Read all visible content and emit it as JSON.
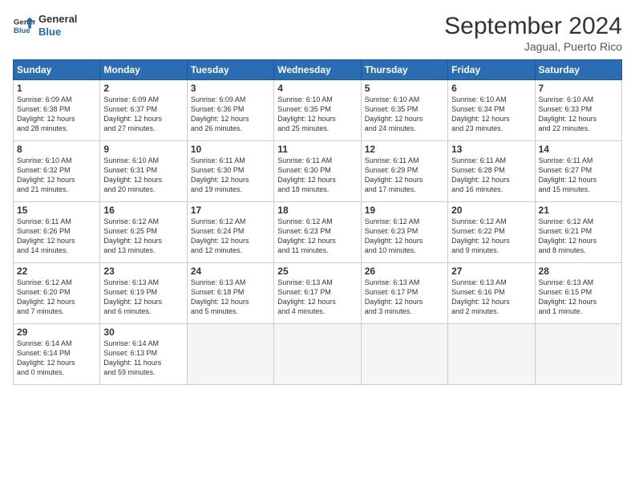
{
  "logo": {
    "line1": "General",
    "line2": "Blue"
  },
  "title": "September 2024",
  "subtitle": "Jagual, Puerto Rico",
  "days_of_week": [
    "Sunday",
    "Monday",
    "Tuesday",
    "Wednesday",
    "Thursday",
    "Friday",
    "Saturday"
  ],
  "weeks": [
    [
      {
        "num": "1",
        "sunrise": "6:09 AM",
        "sunset": "6:38 PM",
        "daylight": "12 hours and 28 minutes."
      },
      {
        "num": "2",
        "sunrise": "6:09 AM",
        "sunset": "6:37 PM",
        "daylight": "12 hours and 27 minutes."
      },
      {
        "num": "3",
        "sunrise": "6:09 AM",
        "sunset": "6:36 PM",
        "daylight": "12 hours and 26 minutes."
      },
      {
        "num": "4",
        "sunrise": "6:10 AM",
        "sunset": "6:35 PM",
        "daylight": "12 hours and 25 minutes."
      },
      {
        "num": "5",
        "sunrise": "6:10 AM",
        "sunset": "6:35 PM",
        "daylight": "12 hours and 24 minutes."
      },
      {
        "num": "6",
        "sunrise": "6:10 AM",
        "sunset": "6:34 PM",
        "daylight": "12 hours and 23 minutes."
      },
      {
        "num": "7",
        "sunrise": "6:10 AM",
        "sunset": "6:33 PM",
        "daylight": "12 hours and 22 minutes."
      }
    ],
    [
      {
        "num": "8",
        "sunrise": "6:10 AM",
        "sunset": "6:32 PM",
        "daylight": "12 hours and 21 minutes."
      },
      {
        "num": "9",
        "sunrise": "6:10 AM",
        "sunset": "6:31 PM",
        "daylight": "12 hours and 20 minutes."
      },
      {
        "num": "10",
        "sunrise": "6:11 AM",
        "sunset": "6:30 PM",
        "daylight": "12 hours and 19 minutes."
      },
      {
        "num": "11",
        "sunrise": "6:11 AM",
        "sunset": "6:30 PM",
        "daylight": "12 hours and 18 minutes."
      },
      {
        "num": "12",
        "sunrise": "6:11 AM",
        "sunset": "6:29 PM",
        "daylight": "12 hours and 17 minutes."
      },
      {
        "num": "13",
        "sunrise": "6:11 AM",
        "sunset": "6:28 PM",
        "daylight": "12 hours and 16 minutes."
      },
      {
        "num": "14",
        "sunrise": "6:11 AM",
        "sunset": "6:27 PM",
        "daylight": "12 hours and 15 minutes."
      }
    ],
    [
      {
        "num": "15",
        "sunrise": "6:11 AM",
        "sunset": "6:26 PM",
        "daylight": "12 hours and 14 minutes."
      },
      {
        "num": "16",
        "sunrise": "6:12 AM",
        "sunset": "6:25 PM",
        "daylight": "12 hours and 13 minutes."
      },
      {
        "num": "17",
        "sunrise": "6:12 AM",
        "sunset": "6:24 PM",
        "daylight": "12 hours and 12 minutes."
      },
      {
        "num": "18",
        "sunrise": "6:12 AM",
        "sunset": "6:23 PM",
        "daylight": "12 hours and 11 minutes."
      },
      {
        "num": "19",
        "sunrise": "6:12 AM",
        "sunset": "6:23 PM",
        "daylight": "12 hours and 10 minutes."
      },
      {
        "num": "20",
        "sunrise": "6:12 AM",
        "sunset": "6:22 PM",
        "daylight": "12 hours and 9 minutes."
      },
      {
        "num": "21",
        "sunrise": "6:12 AM",
        "sunset": "6:21 PM",
        "daylight": "12 hours and 8 minutes."
      }
    ],
    [
      {
        "num": "22",
        "sunrise": "6:12 AM",
        "sunset": "6:20 PM",
        "daylight": "12 hours and 7 minutes."
      },
      {
        "num": "23",
        "sunrise": "6:13 AM",
        "sunset": "6:19 PM",
        "daylight": "12 hours and 6 minutes."
      },
      {
        "num": "24",
        "sunrise": "6:13 AM",
        "sunset": "6:18 PM",
        "daylight": "12 hours and 5 minutes."
      },
      {
        "num": "25",
        "sunrise": "6:13 AM",
        "sunset": "6:17 PM",
        "daylight": "12 hours and 4 minutes."
      },
      {
        "num": "26",
        "sunrise": "6:13 AM",
        "sunset": "6:17 PM",
        "daylight": "12 hours and 3 minutes."
      },
      {
        "num": "27",
        "sunrise": "6:13 AM",
        "sunset": "6:16 PM",
        "daylight": "12 hours and 2 minutes."
      },
      {
        "num": "28",
        "sunrise": "6:13 AM",
        "sunset": "6:15 PM",
        "daylight": "12 hours and 1 minute."
      }
    ],
    [
      {
        "num": "29",
        "sunrise": "6:14 AM",
        "sunset": "6:14 PM",
        "daylight": "12 hours and 0 minutes."
      },
      {
        "num": "30",
        "sunrise": "6:14 AM",
        "sunset": "6:13 PM",
        "daylight": "11 hours and 59 minutes."
      },
      null,
      null,
      null,
      null,
      null
    ]
  ],
  "labels": {
    "sunrise": "Sunrise:",
    "sunset": "Sunset:",
    "daylight": "Daylight:"
  }
}
